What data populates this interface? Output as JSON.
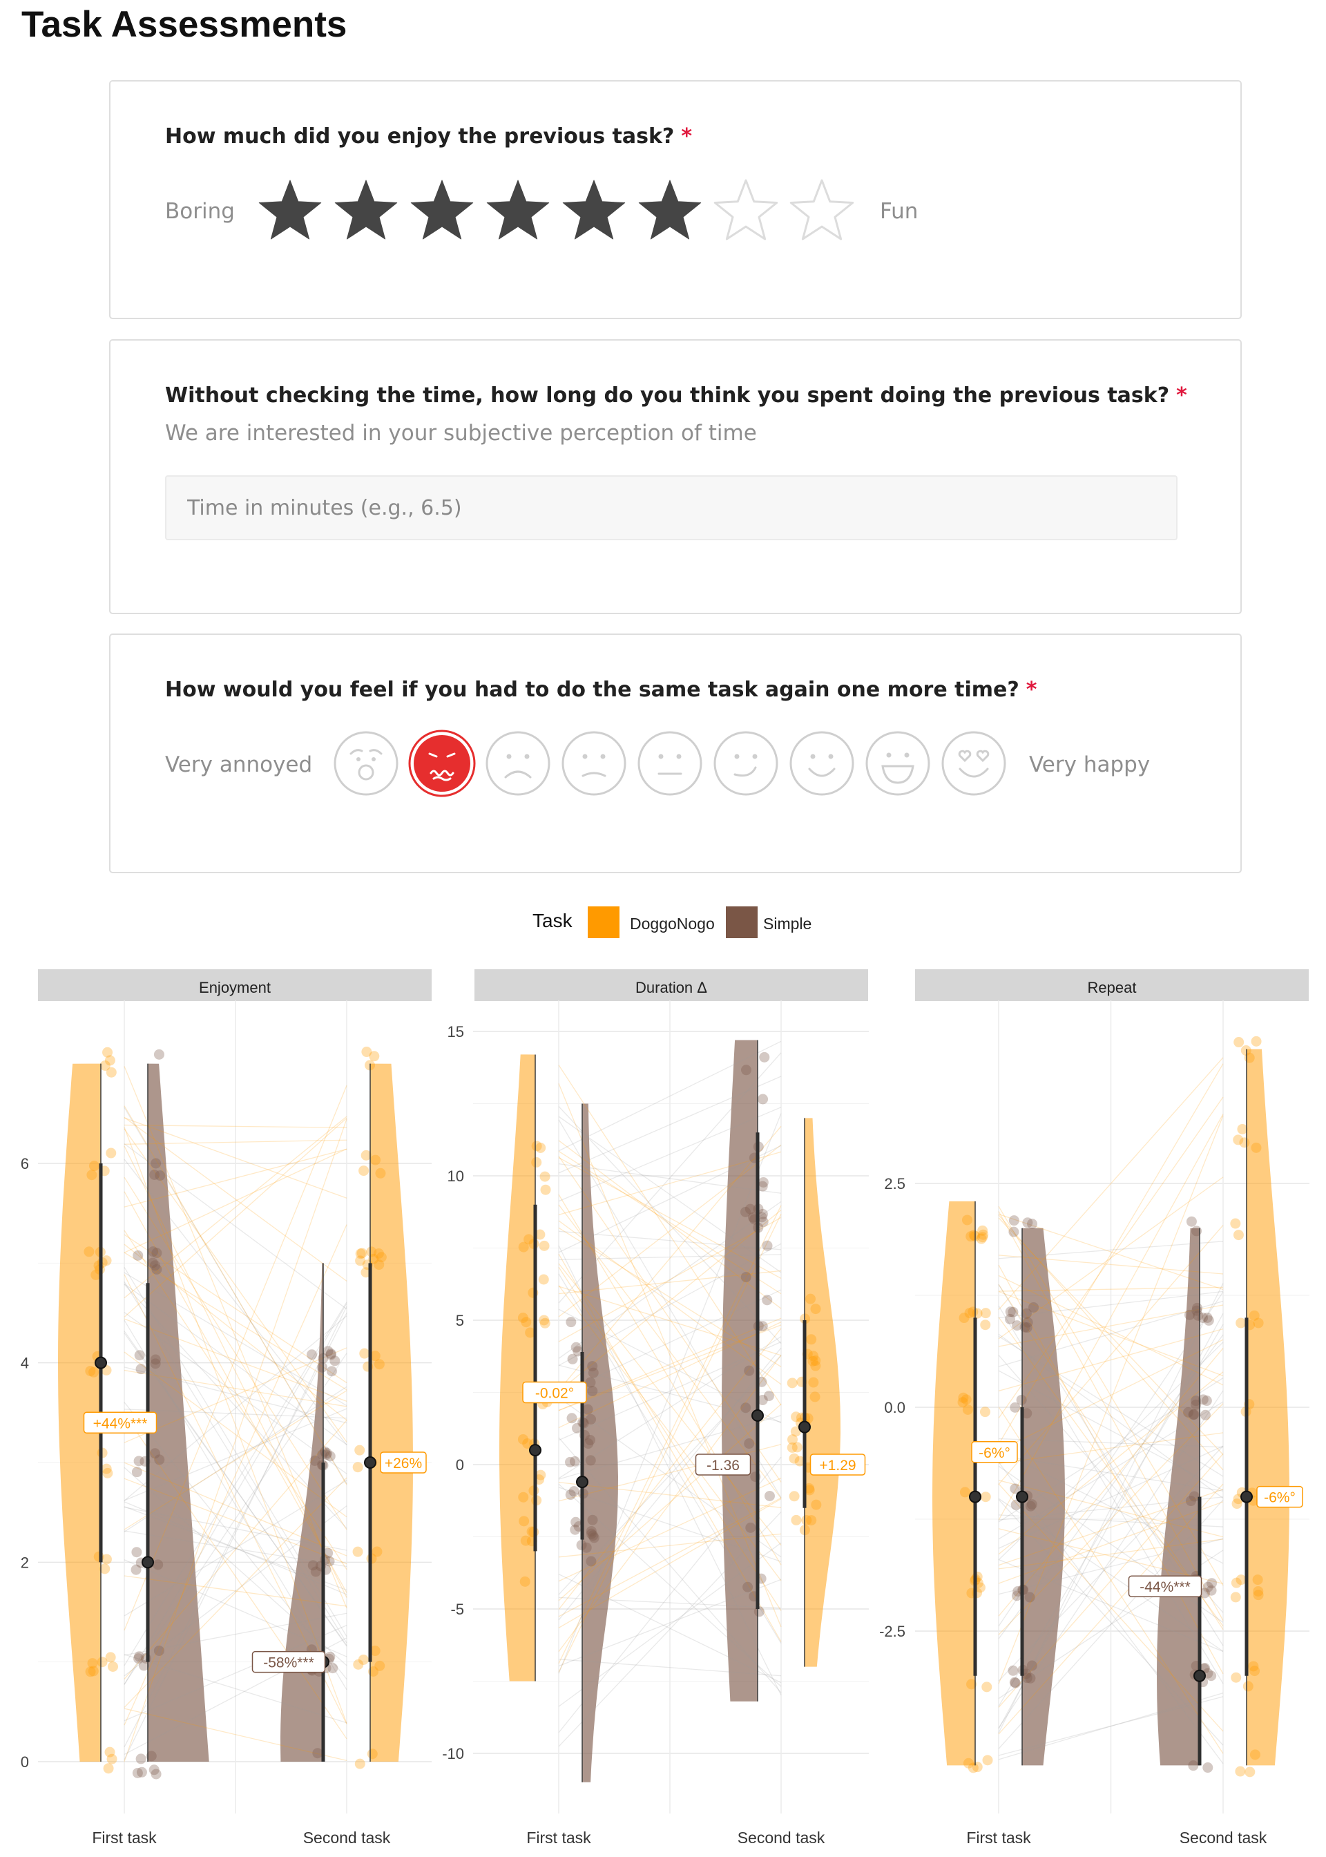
{
  "page": {
    "title": "Task Assessments"
  },
  "survey": {
    "enjoyment": {
      "question": "How much did you enjoy the previous task?",
      "required_mark": "*",
      "left_label": "Boring",
      "right_label": "Fun",
      "rating": 6,
      "max_rating": 8
    },
    "duration": {
      "question": "Without checking the time, how long do you think you spent doing the previous task?",
      "required_mark": "*",
      "description": "We are interested in your subjective perception of time",
      "input_value": "",
      "placeholder": "Time in minutes (e.g., 6.5)"
    },
    "repeat": {
      "question": "How would you feel if you had to do the same task again one more time?",
      "required_mark": "*",
      "left_label": "Very annoyed",
      "right_label": "Very happy",
      "faces": [
        "shocked-face-icon",
        "distressed-face-icon",
        "sad-face-icon",
        "frown-face-icon",
        "neutral-face-icon",
        "smirk-face-icon",
        "smile-face-icon",
        "grin-face-icon",
        "love-face-icon"
      ],
      "selected_index": 1
    }
  },
  "colors": {
    "doggonogo": "#ff9a00",
    "simple": "#7a5646",
    "selected_face": "#e62e2e",
    "star_filled": "#454545",
    "star_empty": "#dcdcdc",
    "strip": "#d6d6d6"
  },
  "chart_data": {
    "type": "violin-raincloud",
    "legend": {
      "title": "Task",
      "placement": "top",
      "items": [
        {
          "name": "DoggoNogo",
          "color": "#ff9a00"
        },
        {
          "name": "Simple",
          "color": "#7a5646"
        }
      ]
    },
    "x_categories": [
      "First task",
      "Second task"
    ],
    "grid": true,
    "panels": [
      {
        "title": "Enjoyment",
        "ylim": [
          -0.2,
          7.4
        ],
        "yticks": [
          0,
          2,
          4,
          6
        ],
        "ytick_labels": [
          "0",
          "2",
          "4",
          "6"
        ],
        "series": [
          {
            "name": "DoggoNogo",
            "first": {
              "median": 4,
              "q1": 2,
              "q3": 6,
              "min": 0,
              "max": 7
            },
            "second": {
              "median": 3,
              "q1": 1,
              "q3": 5,
              "min": 0,
              "max": 7
            }
          },
          {
            "name": "Simple",
            "first": {
              "median": 2,
              "q1": 1,
              "q3": 4.8,
              "min": 0,
              "max": 7
            },
            "second": {
              "median": 1,
              "q1": 0,
              "q3": 3,
              "min": 0,
              "max": 5
            }
          }
        ],
        "annotations": [
          {
            "text": "+44%***",
            "series": "DoggoNogo",
            "x": "First task",
            "y": 3.4
          },
          {
            "text": "+26%",
            "series": "DoggoNogo",
            "x": "Second task",
            "y": 3.0
          },
          {
            "text": "-58%***",
            "series": "Simple",
            "x": "Second task",
            "y": 1.0
          }
        ]
      },
      {
        "title": "Duration Δ",
        "ylim": [
          -11.5,
          15.5
        ],
        "yticks": [
          15,
          10,
          5,
          0,
          -5,
          -10
        ],
        "ytick_labels": [
          "15",
          "10",
          "5",
          "0",
          "-5",
          "-10"
        ],
        "series": [
          {
            "name": "DoggoNogo",
            "first": {
              "median": 0.5,
              "q1": -3,
              "q3": 9,
              "min": -7.5,
              "max": 14.2
            },
            "second": {
              "median": 1.3,
              "q1": -1.5,
              "q3": 5,
              "min": -7,
              "max": 12
            }
          },
          {
            "name": "Simple",
            "first": {
              "median": -0.6,
              "q1": -2.6,
              "q3": 3.9,
              "min": -11,
              "max": 12.5
            },
            "second": {
              "median": 1.7,
              "q1": -5,
              "q3": 11.5,
              "min": -8.2,
              "max": 14.7
            }
          }
        ],
        "annotations": [
          {
            "text": "-0.02°",
            "series": "DoggoNogo",
            "x": "First task",
            "y": 2.5
          },
          {
            "text": "-1.36",
            "series": "Simple",
            "x": "Second task",
            "y": 0
          },
          {
            "text": "+1.29",
            "series": "DoggoNogo",
            "x": "Second task",
            "y": 0
          }
        ]
      },
      {
        "title": "Repeat",
        "ylim": [
          -4.2,
          4.6
        ],
        "yticks": [
          2.5,
          0.0,
          -2.5
        ],
        "ytick_labels": [
          "2.5",
          "0.0",
          "-2.5"
        ],
        "series": [
          {
            "name": "DoggoNogo",
            "first": {
              "median": -1,
              "q1": -3,
              "q3": 1,
              "min": -4,
              "max": 2.3
            },
            "second": {
              "median": -1,
              "q1": -3,
              "q3": 1,
              "min": -4,
              "max": 4
            }
          },
          {
            "name": "Simple",
            "first": {
              "median": -1,
              "q1": -3,
              "q3": 0,
              "min": -4,
              "max": 2
            },
            "second": {
              "median": -3,
              "q1": -4,
              "q3": -1,
              "min": -4,
              "max": 2
            }
          }
        ],
        "annotations": [
          {
            "text": "-6%°",
            "series": "DoggoNogo",
            "x": "First task",
            "y": -0.5
          },
          {
            "text": "-44%***",
            "series": "Simple",
            "x": "Second task",
            "y": -2.0
          },
          {
            "text": "-6%°",
            "series": "DoggoNogo",
            "x": "Second task",
            "y": -1.0
          }
        ]
      }
    ]
  }
}
